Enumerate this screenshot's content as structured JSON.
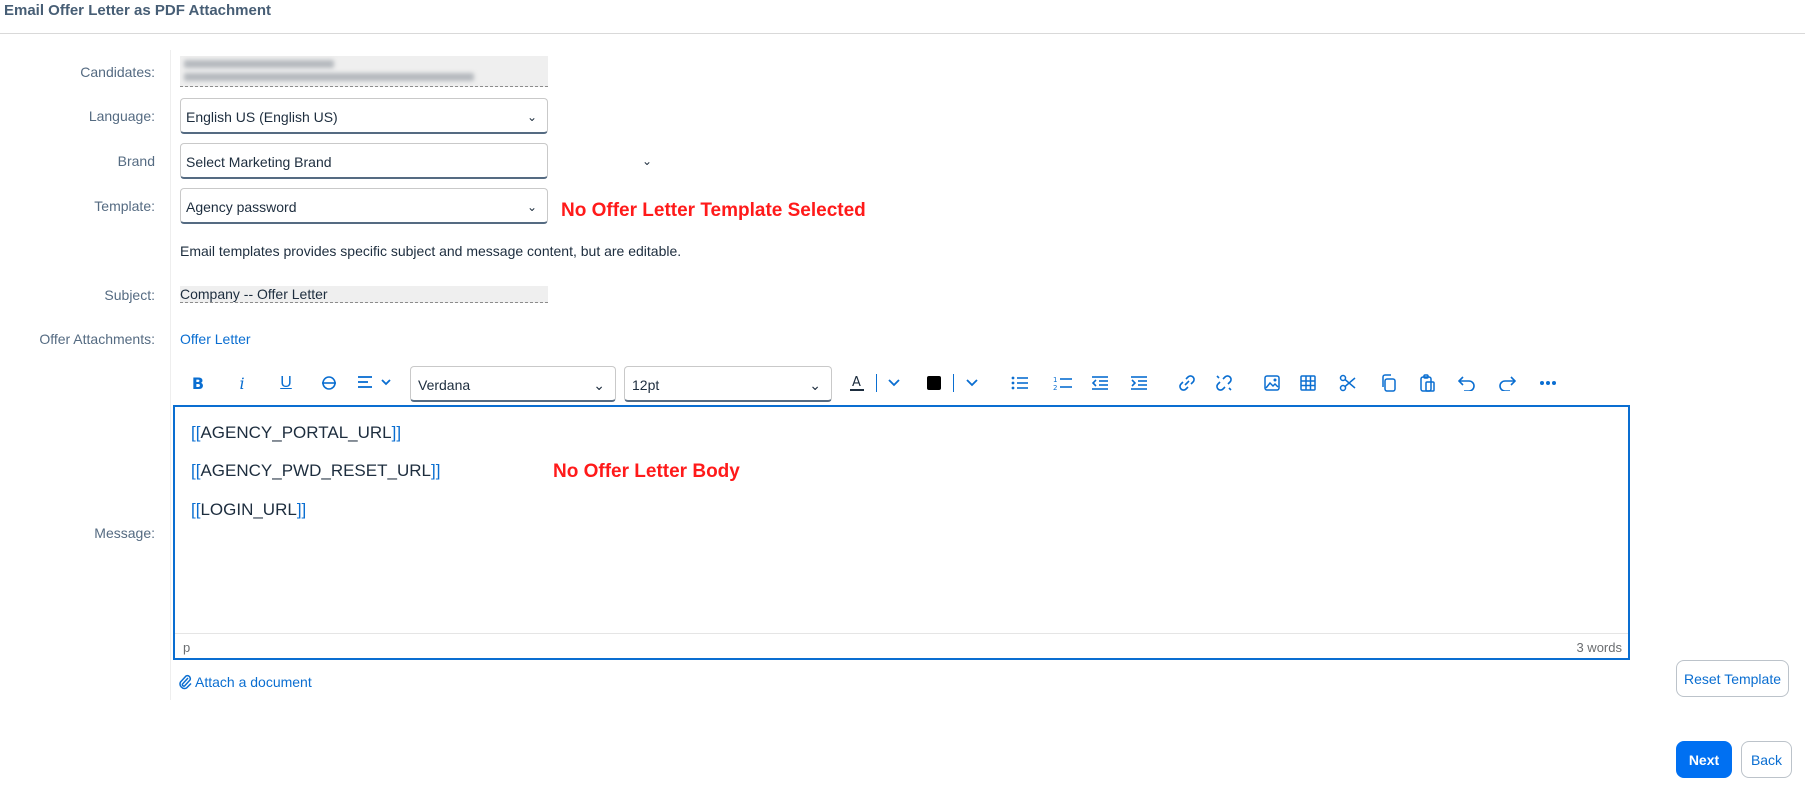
{
  "header": {
    "title": "Email Offer Letter as PDF Attachment"
  },
  "labels": {
    "candidates": "Candidates:",
    "language": "Language:",
    "brand": "Brand",
    "template": "Template:",
    "subject": "Subject:",
    "offer_attachments": "Offer Attachments:",
    "message": "Message:"
  },
  "fields": {
    "language_value": "English US (English US)",
    "brand_value": "Select Marketing Brand",
    "template_value": "Agency password",
    "subject_value": "Company -- Offer Letter",
    "offer_attachment_link": "Offer Letter"
  },
  "warnings": {
    "no_template": "No Offer Letter Template Selected",
    "no_body": "No Offer Letter Body"
  },
  "helper_text": "Email templates provides specific subject and message content, but are editable.",
  "toolbar": {
    "font_family": "Verdana",
    "font_size": "12pt",
    "icons": [
      "bold-icon",
      "italic-icon",
      "underline-icon",
      "strikethrough-icon",
      "align-icon",
      "text-color-icon",
      "background-color-icon",
      "bullet-list-icon",
      "numbered-list-icon",
      "outdent-icon",
      "indent-icon",
      "link-icon",
      "unlink-icon",
      "image-icon",
      "table-icon",
      "cut-icon",
      "copy-icon",
      "paste-icon",
      "undo-icon",
      "redo-icon",
      "more-icon"
    ]
  },
  "editor": {
    "lines": [
      {
        "open": "[[",
        "token": "AGENCY_PORTAL_URL",
        "close": "]]"
      },
      {
        "open": "[[",
        "token": "AGENCY_PWD_RESET_URL",
        "close": "]]"
      },
      {
        "open": "[[",
        "token": "LOGIN_URL",
        "close": "]]"
      }
    ],
    "status_path": "p",
    "word_count": "3 words"
  },
  "actions": {
    "attach_document": "Attach a document",
    "reset_template": "Reset Template",
    "next": "Next",
    "back": "Back"
  },
  "colors": {
    "accent": "#0a6ed1",
    "primary_button": "#0070f2",
    "warning_text": "#ff1a1a",
    "label_text": "#556b82"
  }
}
